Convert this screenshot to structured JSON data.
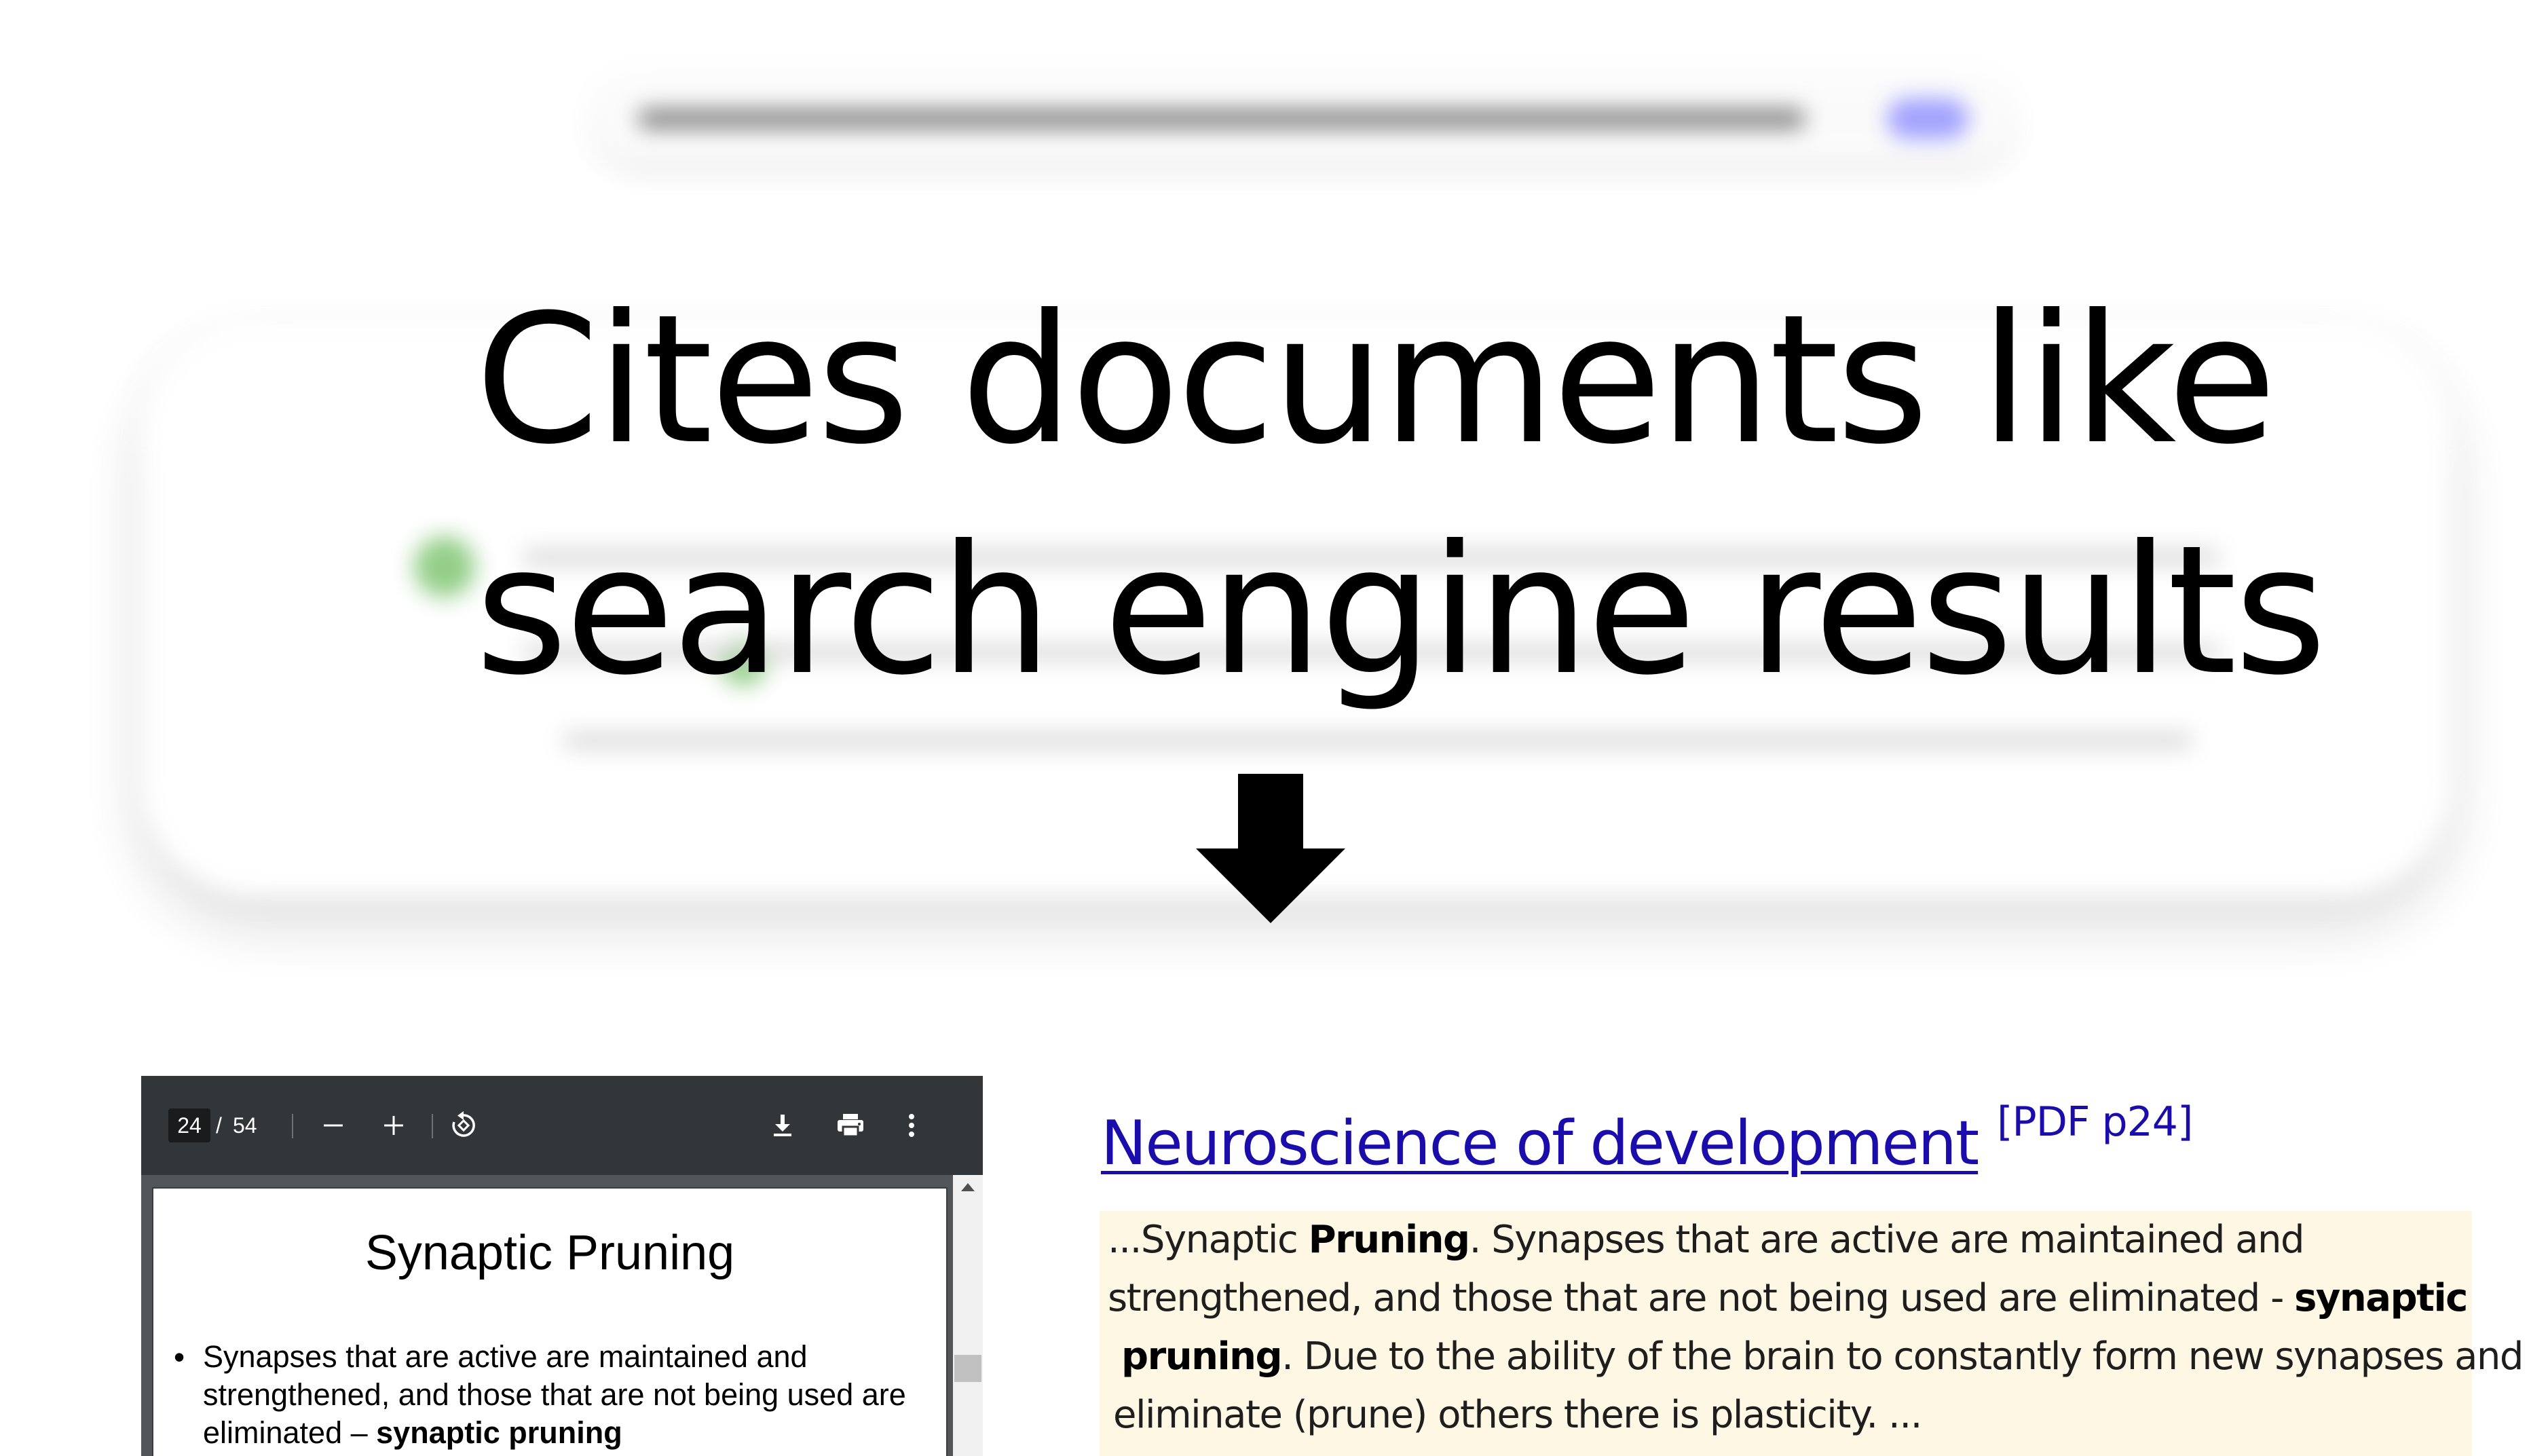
{
  "headline": {
    "line1": "Cites documents like",
    "line2": "search engine results"
  },
  "arrow": {
    "icon": "arrow-down-icon"
  },
  "pdf_viewer": {
    "toolbar": {
      "page_current": "24",
      "page_separator": "/",
      "page_total": "54",
      "icons": [
        "zoom-out-icon",
        "zoom-in-icon",
        "rotate-icon",
        "download-icon",
        "print-icon",
        "more-options-icon"
      ]
    },
    "slide": {
      "title": "Synaptic Pruning",
      "bullet": "•",
      "body_plain": "Synapses that are active are maintained and strengthened, and those that are not being used are eliminated – ",
      "body_bold": "synaptic pruning"
    }
  },
  "result": {
    "title": "Neuroscience of development",
    "pdf_tag": "[PDF p24]",
    "snippet": {
      "l1_a": "...Synaptic ",
      "l1_b": "Pruning",
      "l1_c": ". Synapses that are active are maintained and",
      "l2_a": "strengthened, and those that are not being used are eliminated - ",
      "l2_b": "synaptic",
      "l3_a": "pruning",
      "l3_b": ". Due to the ability of the brain to constantly form new synapses and",
      "l4_a": "eliminate (prune) others there is plasticity.  ..."
    },
    "colors": {
      "link": "#1a0dab",
      "snippet_bg": "#fdf7e4"
    }
  }
}
